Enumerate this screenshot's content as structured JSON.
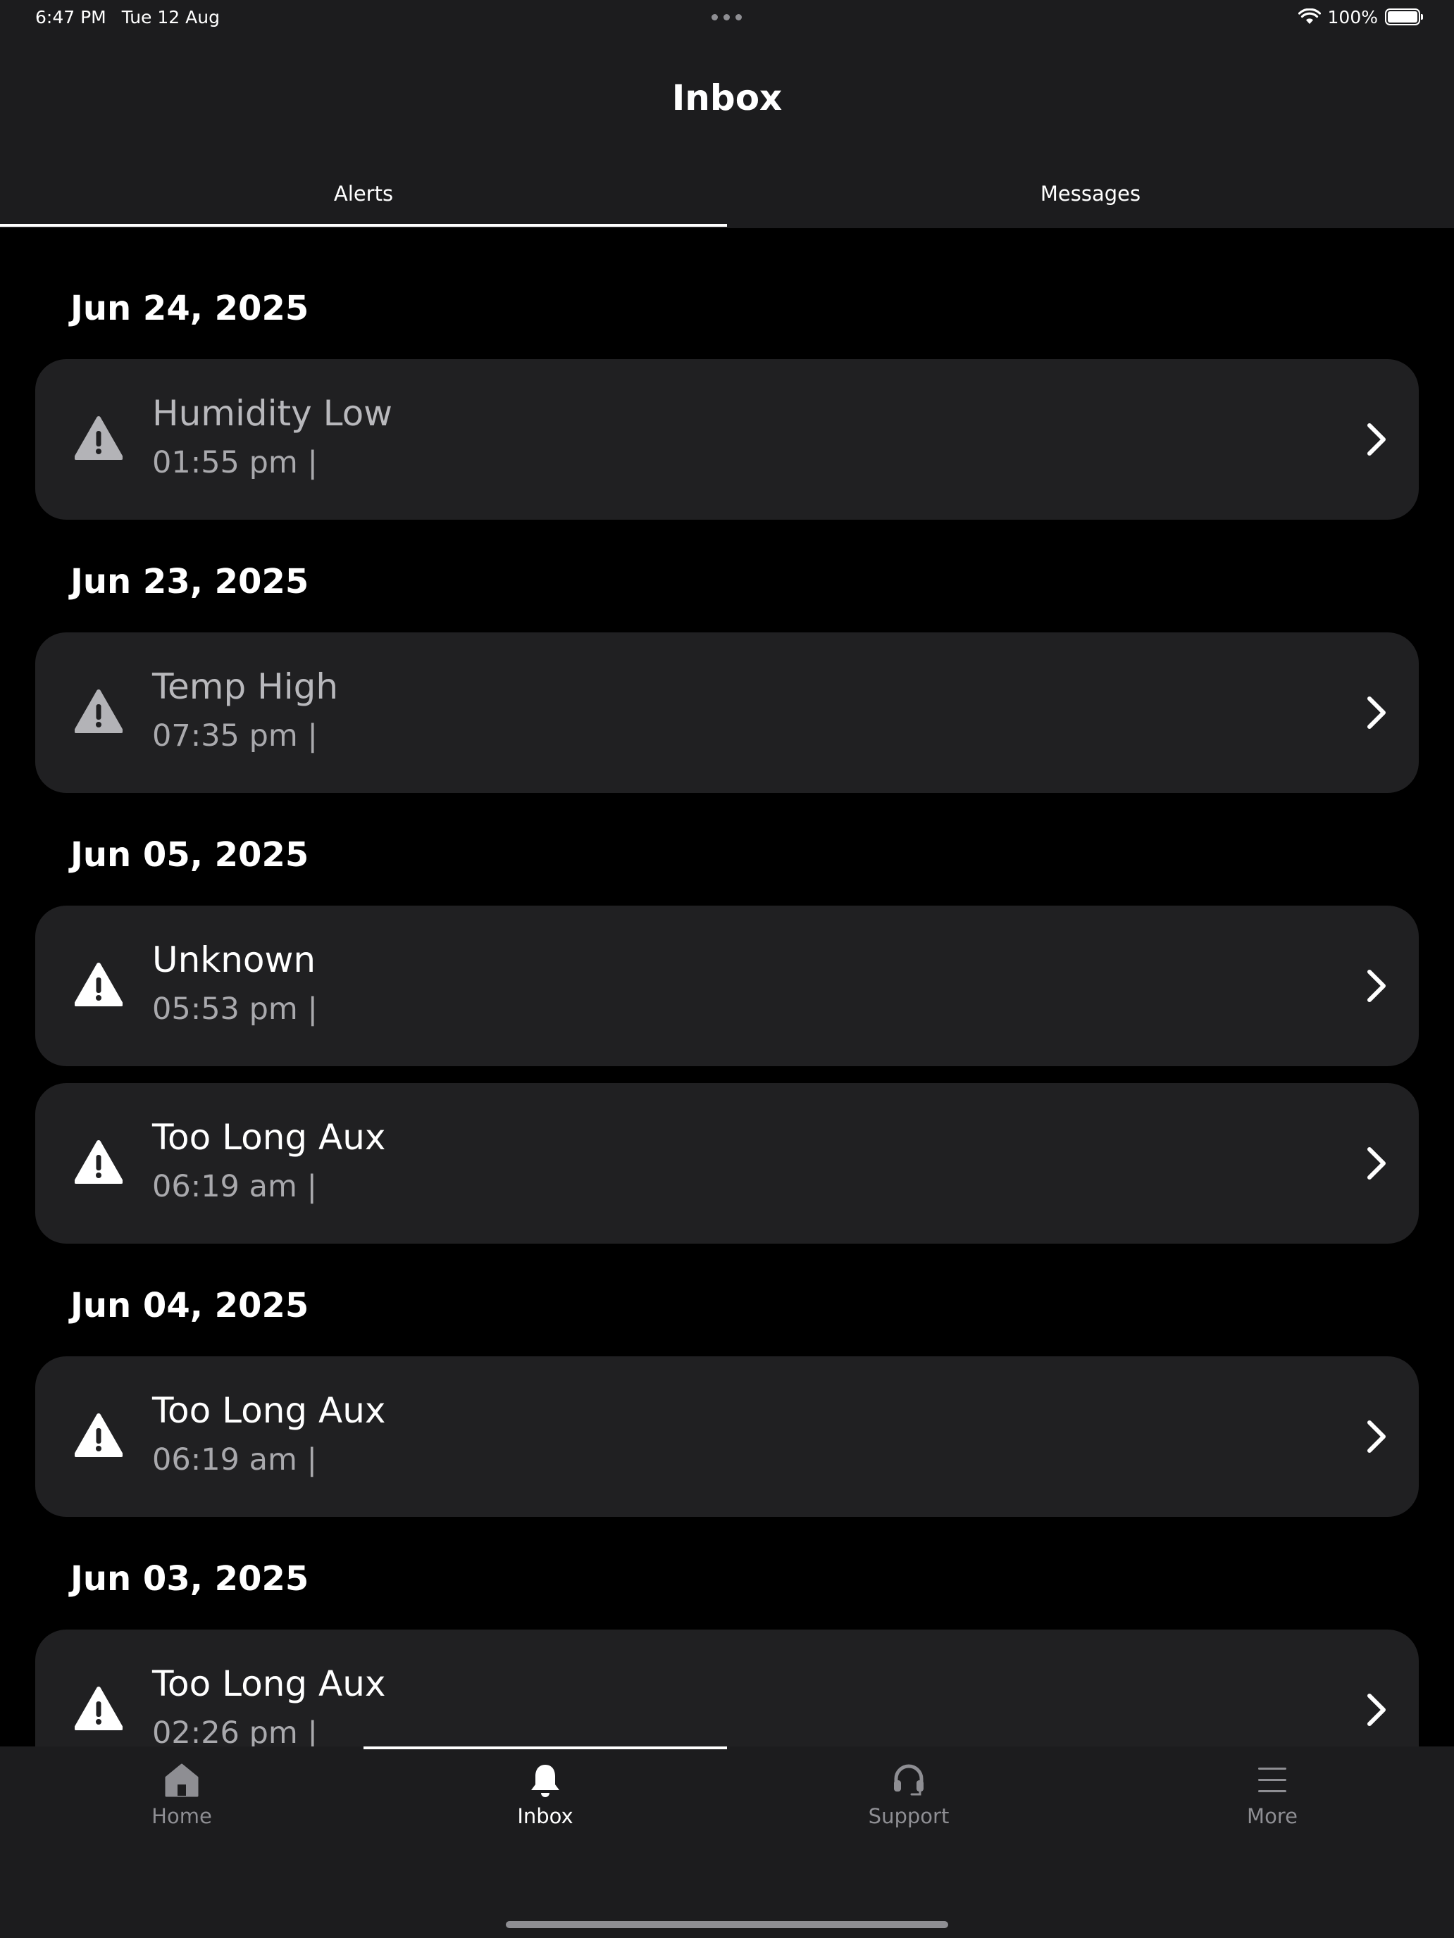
{
  "status_bar": {
    "time": "6:47 PM",
    "date": "Tue 12 Aug",
    "battery": "100%",
    "icons": [
      "wifi-icon",
      "battery-icon"
    ]
  },
  "header": {
    "title": "Inbox",
    "tabs": [
      {
        "label": "Alerts",
        "selected": true
      },
      {
        "label": "Messages",
        "selected": false
      }
    ]
  },
  "groups": [
    {
      "date": "Jun 24, 2025",
      "alerts": [
        {
          "title": "Humidity Low",
          "time": "01:55 pm |"
        }
      ]
    },
    {
      "date": "Jun 23, 2025",
      "alerts": [
        {
          "title": "Temp High",
          "time": "07:35 pm |"
        }
      ]
    },
    {
      "date": "Jun 05, 2025",
      "alerts": [
        {
          "title": "Unknown",
          "time": "05:53 pm |"
        },
        {
          "title": "Too Long Aux",
          "time": "06:19 am |"
        }
      ]
    },
    {
      "date": "Jun 04, 2025",
      "alerts": [
        {
          "title": "Too Long Aux",
          "time": "06:19 am |"
        }
      ]
    },
    {
      "date": "Jun 03, 2025",
      "alerts": [
        {
          "title": "Too Long Aux",
          "time": "02:26 pm |"
        }
      ]
    }
  ],
  "tabbar": {
    "items": [
      {
        "label": "Home",
        "icon": "home-icon",
        "active": false
      },
      {
        "label": "Inbox",
        "icon": "bell-icon",
        "active": true
      },
      {
        "label": "Support",
        "icon": "headset-icon",
        "active": false
      },
      {
        "label": "More",
        "icon": "menu-icon",
        "active": false
      }
    ]
  },
  "colors": {
    "background": "#000000",
    "surface": "#1c1c1e",
    "card": "#202022",
    "text_primary": "#ffffff",
    "text_muted": "#a9a9ad",
    "icon_muted": "#b3b3b7",
    "inactive": "#8e8e93"
  }
}
